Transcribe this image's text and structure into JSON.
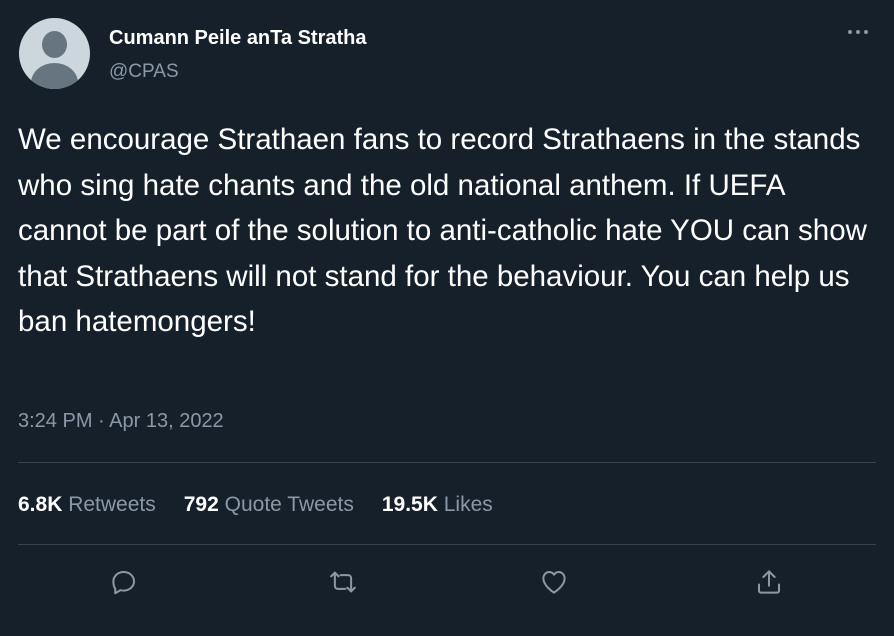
{
  "author": {
    "name": "Cumann Peile anTa Stratha",
    "handle": "@CPAS"
  },
  "tweet": {
    "text": "We encourage Strathaen fans to record Strathaens in the stands who sing hate chants and the old national anthem. If UEFA cannot be part of the solution to anti-catholic hate YOU can show that Strathaens will not stand for the behaviour. You can help us ban hatemongers!",
    "timestamp": "3:24 PM · Apr 13, 2022"
  },
  "stats": {
    "retweets_count": "6.8K",
    "retweets_label": "Retweets",
    "quotes_count": "792",
    "quotes_label": "Quote Tweets",
    "likes_count": "19.5K",
    "likes_label": "Likes"
  },
  "icons": {
    "more": "more-horizontal-icon",
    "reply": "reply-icon",
    "retweet": "retweet-icon",
    "like": "heart-icon",
    "share": "share-icon"
  },
  "colors": {
    "background": "#15202b",
    "primary_text": "#ffffff",
    "secondary_text": "#8b98a5",
    "divider": "#38444d"
  }
}
